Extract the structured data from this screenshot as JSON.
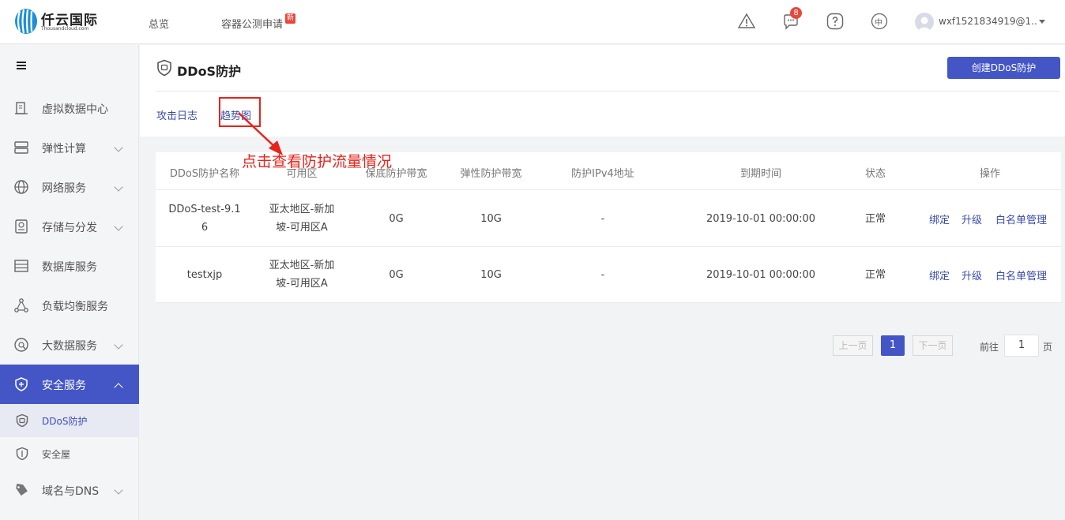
{
  "brand": {
    "name": "仟云国际",
    "sub": "Thousandcloud.com"
  },
  "topnav": [
    {
      "label": "总览"
    },
    {
      "label": "容器公测申请",
      "badge": "新"
    }
  ],
  "top_icons": {
    "alert": "warning-icon",
    "messages": "chat-icon",
    "message_count": "8",
    "help": "help-icon",
    "lang": "中"
  },
  "user": {
    "name": "wxf1521834919@1..."
  },
  "sidebar": {
    "items": [
      {
        "label": "虚拟数据中心",
        "icon": "datacenter-icon"
      },
      {
        "label": "弹性计算",
        "icon": "compute-icon"
      },
      {
        "label": "网络服务",
        "icon": "network-icon"
      },
      {
        "label": "存储与分发",
        "icon": "storage-icon"
      },
      {
        "label": "数据库服务",
        "icon": "database-icon"
      },
      {
        "label": "负载均衡服务",
        "icon": "load-balancer-icon"
      },
      {
        "label": "大数据服务",
        "icon": "bigdata-icon"
      },
      {
        "label": "安全服务",
        "icon": "security-icon"
      },
      {
        "label": "域名与DNS",
        "icon": "domain-icon"
      }
    ],
    "sub_items": [
      {
        "label": "DDoS防护",
        "icon": "ddos-shield-icon"
      },
      {
        "label": "安全屋",
        "icon": "safe-house-icon"
      }
    ]
  },
  "page": {
    "title": "DDoS防护",
    "create_button": "创建DDoS防护",
    "tabs": [
      "攻击日志",
      "趋势图"
    ]
  },
  "annotation": {
    "text": "点击查看防护流量情况"
  },
  "table": {
    "columns": [
      "DDoS防护名称",
      "可用区",
      "保底防护带宽",
      "弹性防护带宽",
      "防护IPv4地址",
      "到期时间",
      "状态",
      "操作"
    ],
    "rows": [
      {
        "name_line1": "DDoS-test-9.1",
        "name_line2": "6",
        "zone_line1": "亚太地区-新加",
        "zone_line2": "坡-可用区A",
        "base_bw": "0G",
        "elastic_bw": "10G",
        "ipv4": "-",
        "expire": "2019-10-01 00:00:00",
        "status": "正常",
        "ops": [
          "绑定",
          "升级",
          "白名单管理"
        ]
      },
      {
        "name_line1": "testxjp",
        "name_line2": "",
        "zone_line1": "亚太地区-新加",
        "zone_line2": "坡-可用区A",
        "base_bw": "0G",
        "elastic_bw": "10G",
        "ipv4": "-",
        "expire": "2019-10-01 00:00:00",
        "status": "正常",
        "ops": [
          "绑定",
          "升级",
          "白名单管理"
        ]
      }
    ]
  },
  "pagination": {
    "prev": "上一页",
    "current": "1",
    "next": "下一页",
    "goto_label": "前往",
    "goto_value": "1",
    "page_unit": "页"
  },
  "colors": {
    "accent": "#4456c5",
    "annotation": "#e8231b",
    "badge": "#e8473c"
  }
}
